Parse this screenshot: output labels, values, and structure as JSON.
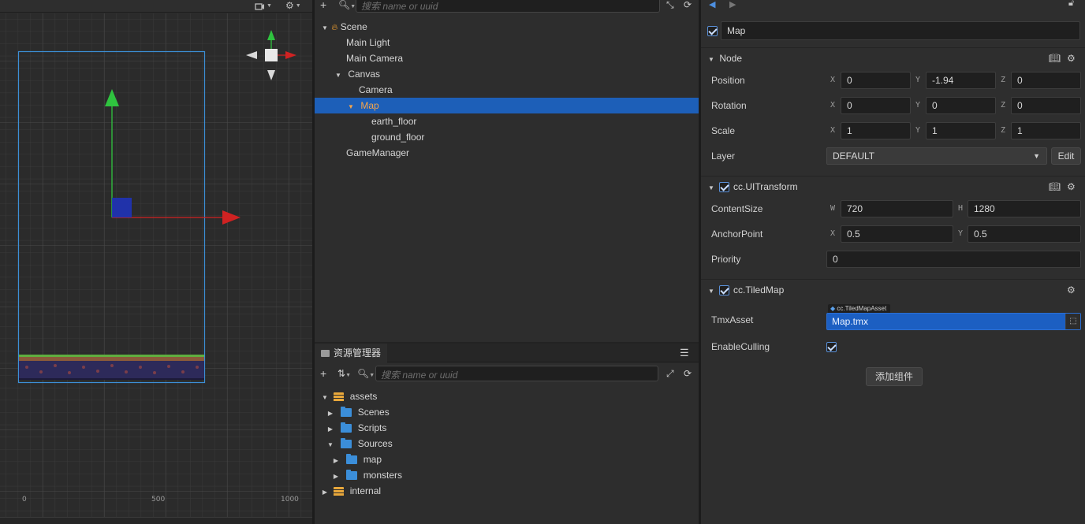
{
  "scene": {
    "toolbar_icons": [
      "camera-icon",
      "gear-icon"
    ],
    "ruler_labels": [
      "0",
      "500",
      "1000"
    ]
  },
  "hierarchy": {
    "search_placeholder": "搜索 name or uuid",
    "items": [
      {
        "label": "Scene",
        "depth": 0,
        "expanded": true,
        "icon": "scene-fire-icon"
      },
      {
        "label": "Main Light",
        "depth": 1
      },
      {
        "label": "Main Camera",
        "depth": 1
      },
      {
        "label": "Canvas",
        "depth": 1,
        "expanded": true
      },
      {
        "label": "Camera",
        "depth": 2
      },
      {
        "label": "Map",
        "depth": 2,
        "expanded": true,
        "selected": true
      },
      {
        "label": "earth_floor",
        "depth": 3
      },
      {
        "label": "ground_floor",
        "depth": 3
      },
      {
        "label": "GameManager",
        "depth": 1
      }
    ]
  },
  "assets": {
    "tab_label": "资源管理器",
    "search_placeholder": "搜索 name or uuid",
    "items": [
      {
        "label": "assets",
        "depth": 0,
        "expanded": true,
        "icon": "database-icon"
      },
      {
        "label": "Scenes",
        "depth": 1,
        "expanded": false,
        "icon": "folder-icon"
      },
      {
        "label": "Scripts",
        "depth": 1,
        "expanded": false,
        "icon": "folder-icon"
      },
      {
        "label": "Sources",
        "depth": 1,
        "expanded": true,
        "icon": "folder-icon"
      },
      {
        "label": "map",
        "depth": 2,
        "expanded": false,
        "icon": "folder-icon"
      },
      {
        "label": "monsters",
        "depth": 2,
        "expanded": false,
        "icon": "folder-icon"
      },
      {
        "label": "internal",
        "depth": 0,
        "expanded": false,
        "icon": "database-icon"
      }
    ]
  },
  "inspector": {
    "node_name": "Map",
    "node_section": "Node",
    "position": {
      "label": "Position",
      "x": "0",
      "y": "-1.94",
      "z": "0"
    },
    "rotation": {
      "label": "Rotation",
      "x": "0",
      "y": "0",
      "z": "0"
    },
    "scale": {
      "label": "Scale",
      "x": "1",
      "y": "1",
      "z": "1"
    },
    "layer": {
      "label": "Layer",
      "value": "DEFAULT",
      "edit_label": "Edit"
    },
    "uitransform": {
      "title": "cc.UITransform",
      "content_size_label": "ContentSize",
      "w": "720",
      "h": "1280",
      "anchor_label": "AnchorPoint",
      "ax": "0.5",
      "ay": "0.5",
      "priority_label": "Priority",
      "priority": "0"
    },
    "tiledmap": {
      "title": "cc.TiledMap",
      "tmx_label": "TmxAsset",
      "asset_type": "cc.TiledMapAsset",
      "tmx_value": "Map.tmx",
      "culling_label": "EnableCulling"
    },
    "add_component_label": "添加组件",
    "axis": {
      "x": "X",
      "y": "Y",
      "z": "Z",
      "w": "W",
      "h": "H"
    }
  },
  "colors": {
    "selection": "#1d5fb8",
    "selected_text": "#f7a54a",
    "accent": "#3b8ed9"
  }
}
